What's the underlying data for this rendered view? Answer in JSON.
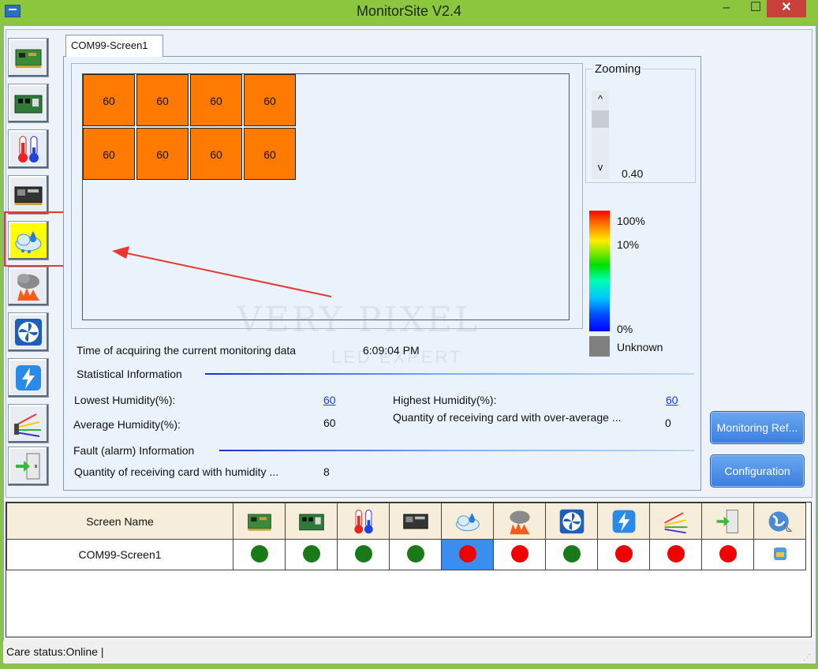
{
  "window": {
    "title": "MonitorSite V2.4",
    "min": "–",
    "max": "☐",
    "close": "✕"
  },
  "sidebar": {
    "items": [
      {
        "name": "sending-card-icon"
      },
      {
        "name": "receiving-card-icon"
      },
      {
        "name": "temperature-icon"
      },
      {
        "name": "monitoring-card-icon"
      },
      {
        "name": "humidity-icon",
        "active": true
      },
      {
        "name": "smoke-icon"
      },
      {
        "name": "fan-icon"
      },
      {
        "name": "power-icon"
      },
      {
        "name": "cable-icon"
      },
      {
        "name": "door-icon"
      }
    ]
  },
  "tab": {
    "label": "COM99-Screen1"
  },
  "cells": [
    "60",
    "60",
    "60",
    "60",
    "60",
    "60",
    "60",
    "60"
  ],
  "zoom": {
    "title": "Zooming",
    "up": "^",
    "down": "v",
    "value": "0.40"
  },
  "legend": {
    "p100": "100%",
    "p10": "10%",
    "p0": "0%",
    "unknown": "Unknown",
    "colors": [
      "#ff0000",
      "#ffee00",
      "#00e000",
      "#00c8ff",
      "#0000ff"
    ],
    "unknown_color": "#808080"
  },
  "info": {
    "time_label": "Time of acquiring the current monitoring data",
    "time_value": "6:09:04 PM",
    "stat_title": "Statistical Information",
    "lowest_label": "Lowest Humidity(%):",
    "lowest_value": "60",
    "highest_label": "Highest Humidity(%):",
    "highest_value": "60",
    "average_label": "Average Humidity(%):",
    "average_value": "60",
    "over_avg_label": "Quantity of receiving card with over-average ...",
    "over_avg_value": "0",
    "fault_title": "Fault (alarm) Information",
    "fault_label": "Quantity of receiving card with humidity ...",
    "fault_value": "8"
  },
  "watermark": {
    "line1": "VERY PIXEL",
    "line2": "LED EXPERT"
  },
  "buttons": {
    "refresh": "Monitoring Ref...",
    "config": "Configuration"
  },
  "table": {
    "header": "Screen Name",
    "rows": [
      {
        "name": "COM99-Screen1",
        "status": [
          "green",
          "green",
          "green",
          "green",
          "red",
          "red",
          "green",
          "red",
          "red",
          "red",
          "info"
        ]
      }
    ]
  },
  "statusbar": {
    "text": "Care status:Online  |"
  }
}
